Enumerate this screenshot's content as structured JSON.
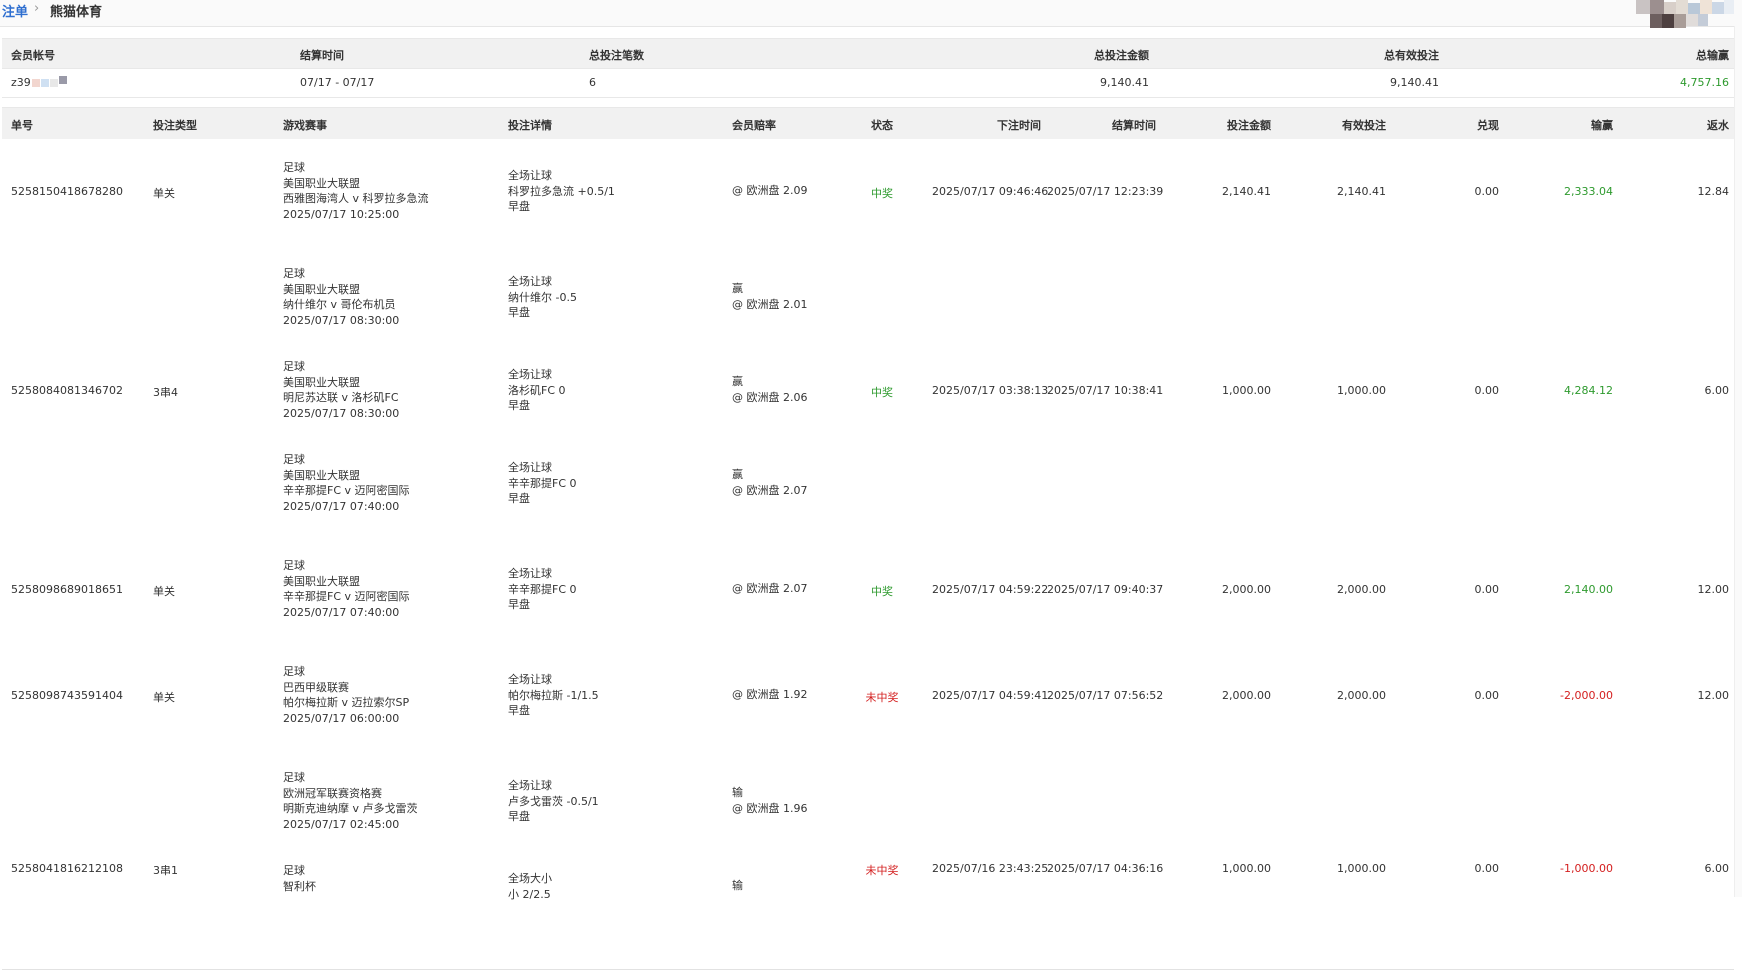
{
  "breadcrumb": {
    "root": "注单",
    "separator": "›",
    "current": "熊猫体育"
  },
  "summary": {
    "headers": [
      "会员帐号",
      "结算时间",
      "总投注笔数",
      "总投注金额",
      "总有效投注",
      "总输赢"
    ],
    "account": "z39",
    "settle_range": "07/17 - 07/17",
    "count": "6",
    "total_bet": "9,140.41",
    "total_valid": "9,140.41",
    "total_win": "4,757.16"
  },
  "table": {
    "headers": [
      "单号",
      "投注类型",
      "游戏赛事",
      "投注详情",
      "会员赔率",
      "状态",
      "下注时间",
      "结算时间",
      "投注金额",
      "有效投注",
      "兑现",
      "输赢",
      "返水"
    ],
    "rows": [
      {
        "id": "5258150418678280",
        "type": "单关",
        "status": "中奖",
        "status_color": "#2e9a2e",
        "bet_time": "2025/07/17 09:46:46",
        "settle_time": "2025/07/17 12:23:39",
        "amount": "2,140.41",
        "valid": "2,140.41",
        "cashout": "0.00",
        "win": "2,333.04",
        "win_color": "#2e9a2e",
        "rebate": "12.84",
        "legs": [
          {
            "event": [
              "足球",
              "美国职业大联盟",
              "西雅图海湾人 v 科罗拉多急流",
              "2025/07/17 10:25:00"
            ],
            "detail": [
              "全场让球",
              "科罗拉多急流 +0.5/1",
              "早盘"
            ],
            "odds": [
              "@ 欧洲盘 2.09"
            ]
          }
        ]
      },
      {
        "id": "5258084081346702",
        "type": "3串4",
        "status": "中奖",
        "status_color": "#2e9a2e",
        "bet_time": "2025/07/17 03:38:13",
        "settle_time": "2025/07/17 10:38:41",
        "amount": "1,000.00",
        "valid": "1,000.00",
        "cashout": "0.00",
        "win": "4,284.12",
        "win_color": "#2e9a2e",
        "rebate": "6.00",
        "legs": [
          {
            "event": [
              "足球",
              "美国职业大联盟",
              "纳什维尔 v 哥伦布机员",
              "2025/07/17 08:30:00"
            ],
            "detail": [
              "全场让球",
              "纳什维尔 -0.5",
              "早盘"
            ],
            "odds": [
              "赢",
              "@ 欧洲盘 2.01"
            ]
          },
          {
            "event": [
              "足球",
              "美国职业大联盟",
              "明尼苏达联 v 洛杉矶FC",
              "2025/07/17 08:30:00"
            ],
            "detail": [
              "全场让球",
              "洛杉矶FC 0",
              "早盘"
            ],
            "odds": [
              "赢",
              "@ 欧洲盘 2.06"
            ]
          },
          {
            "event": [
              "足球",
              "美国职业大联盟",
              "辛辛那提FC v 迈阿密国际",
              "2025/07/17 07:40:00"
            ],
            "detail": [
              "全场让球",
              "辛辛那提FC 0",
              "早盘"
            ],
            "odds": [
              "赢",
              "@ 欧洲盘 2.07"
            ]
          }
        ]
      },
      {
        "id": "5258098689018651",
        "type": "单关",
        "status": "中奖",
        "status_color": "#2e9a2e",
        "bet_time": "2025/07/17 04:59:22",
        "settle_time": "2025/07/17 09:40:37",
        "amount": "2,000.00",
        "valid": "2,000.00",
        "cashout": "0.00",
        "win": "2,140.00",
        "win_color": "#2e9a2e",
        "rebate": "12.00",
        "legs": [
          {
            "event": [
              "足球",
              "美国职业大联盟",
              "辛辛那提FC v 迈阿密国际",
              "2025/07/17 07:40:00"
            ],
            "detail": [
              "全场让球",
              "辛辛那提FC 0",
              "早盘"
            ],
            "odds": [
              "@ 欧洲盘 2.07"
            ]
          }
        ]
      },
      {
        "id": "5258098743591404",
        "type": "单关",
        "status": "未中奖",
        "status_color": "#d42020",
        "bet_time": "2025/07/17 04:59:41",
        "settle_time": "2025/07/17 07:56:52",
        "amount": "2,000.00",
        "valid": "2,000.00",
        "cashout": "0.00",
        "win": "-2,000.00",
        "win_color": "#d42020",
        "rebate": "12.00",
        "legs": [
          {
            "event": [
              "足球",
              "巴西甲级联赛",
              "帕尔梅拉斯 v 迈拉索尔SP",
              "2025/07/17 06:00:00"
            ],
            "detail": [
              "全场让球",
              "帕尔梅拉斯 -1/1.5",
              "早盘"
            ],
            "odds": [
              "@ 欧洲盘 1.92"
            ]
          }
        ]
      },
      {
        "id": "5258041816212108",
        "type": "3串1",
        "status": "未中奖",
        "status_color": "#d42020",
        "bet_time": "2025/07/16 23:43:25",
        "settle_time": "2025/07/17 04:36:16",
        "amount": "1,000.00",
        "valid": "1,000.00",
        "cashout": "0.00",
        "win": "-1,000.00",
        "win_color": "#d42020",
        "rebate": "6.00",
        "legs": [
          {
            "event": [
              "足球",
              "欧洲冠军联赛资格赛",
              "明斯克迪纳摩 v 卢多戈雷茨",
              "2025/07/17 02:45:00"
            ],
            "detail": [
              "全场让球",
              "卢多戈雷茨 -0.5/1",
              "早盘"
            ],
            "odds": [
              "输",
              "@ 欧洲盘 1.96"
            ]
          },
          {
            "event": [
              "足球",
              "智利杯",
              "",
              ""
            ],
            "detail": [
              "全场大小",
              "小 2/2.5",
              ""
            ],
            "odds": [
              "输",
              ""
            ]
          }
        ]
      }
    ]
  },
  "colors": {
    "link": "#2f6fd0",
    "win": "#2e9a2e",
    "loss": "#d42020",
    "header_bg": "#f1f1f1"
  }
}
